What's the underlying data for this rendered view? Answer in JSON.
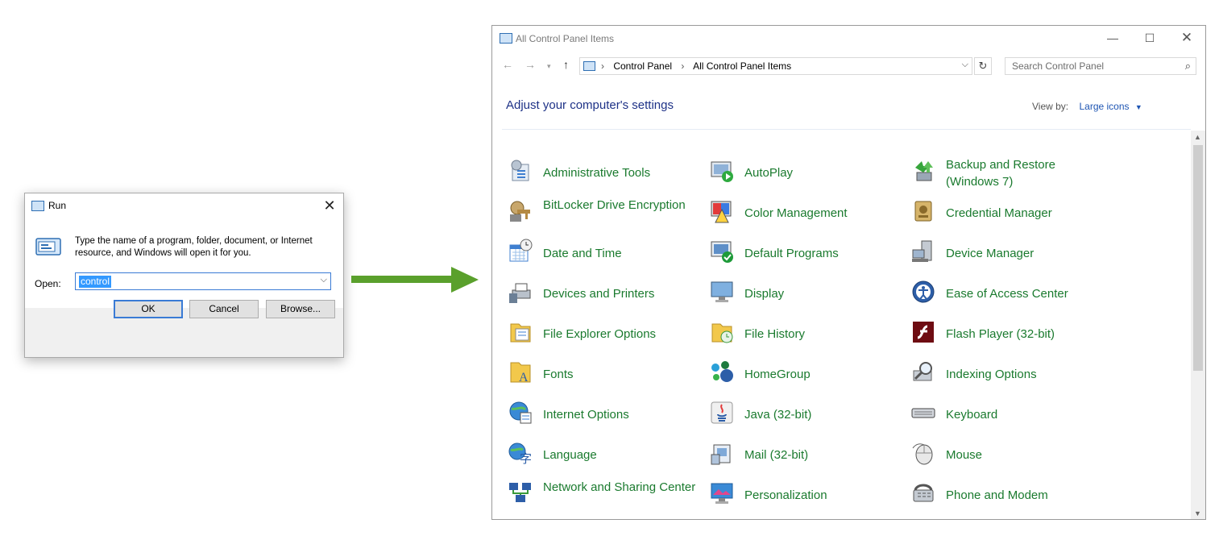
{
  "run_dialog": {
    "title": "Run",
    "description": "Type the name of a program, folder, document, or Internet resource, and Windows will open it for you.",
    "open_label": "Open:",
    "open_value": "control",
    "buttons": {
      "ok": "OK",
      "cancel": "Cancel",
      "browse": "Browse..."
    }
  },
  "control_panel": {
    "window_title": "All Control Panel Items",
    "breadcrumb": [
      "Control Panel",
      "All Control Panel Items"
    ],
    "search_placeholder": "Search Control Panel",
    "heading": "Adjust your computer's settings",
    "view_by_label": "View by:",
    "view_by_value": "Large icons",
    "items": [
      {
        "label": "Administrative Tools",
        "icon": "administrative-tools-icon",
        "col": 0,
        "row": 0
      },
      {
        "label": "AutoPlay",
        "icon": "autoplay-icon",
        "col": 1,
        "row": 0
      },
      {
        "label": "Backup and Restore (Windows 7)",
        "icon": "backup-restore-icon",
        "col": 2,
        "row": 0
      },
      {
        "label": "BitLocker Drive Encryption",
        "icon": "bitlocker-icon",
        "col": 0,
        "row": 1
      },
      {
        "label": "Color Management",
        "icon": "color-management-icon",
        "col": 1,
        "row": 1
      },
      {
        "label": "Credential Manager",
        "icon": "credential-manager-icon",
        "col": 2,
        "row": 1
      },
      {
        "label": "Date and Time",
        "icon": "date-time-icon",
        "col": 0,
        "row": 2
      },
      {
        "label": "Default Programs",
        "icon": "default-programs-icon",
        "col": 1,
        "row": 2
      },
      {
        "label": "Device Manager",
        "icon": "device-manager-icon",
        "col": 2,
        "row": 2
      },
      {
        "label": "Devices and Printers",
        "icon": "devices-printers-icon",
        "col": 0,
        "row": 3
      },
      {
        "label": "Display",
        "icon": "display-icon",
        "col": 1,
        "row": 3
      },
      {
        "label": "Ease of Access Center",
        "icon": "ease-of-access-icon",
        "col": 2,
        "row": 3
      },
      {
        "label": "File Explorer Options",
        "icon": "file-explorer-options-icon",
        "col": 0,
        "row": 4
      },
      {
        "label": "File History",
        "icon": "file-history-icon",
        "col": 1,
        "row": 4
      },
      {
        "label": "Flash Player (32-bit)",
        "icon": "flash-player-icon",
        "col": 2,
        "row": 4
      },
      {
        "label": "Fonts",
        "icon": "fonts-icon",
        "col": 0,
        "row": 5
      },
      {
        "label": "HomeGroup",
        "icon": "homegroup-icon",
        "col": 1,
        "row": 5
      },
      {
        "label": "Indexing Options",
        "icon": "indexing-options-icon",
        "col": 2,
        "row": 5
      },
      {
        "label": "Internet Options",
        "icon": "internet-options-icon",
        "col": 0,
        "row": 6
      },
      {
        "label": "Java (32-bit)",
        "icon": "java-icon",
        "col": 1,
        "row": 6
      },
      {
        "label": "Keyboard",
        "icon": "keyboard-icon",
        "col": 2,
        "row": 6
      },
      {
        "label": "Language",
        "icon": "language-icon",
        "col": 0,
        "row": 7
      },
      {
        "label": "Mail (32-bit)",
        "icon": "mail-icon",
        "col": 1,
        "row": 7
      },
      {
        "label": "Mouse",
        "icon": "mouse-icon",
        "col": 2,
        "row": 7
      },
      {
        "label": "Network and Sharing Center",
        "icon": "network-sharing-icon",
        "col": 0,
        "row": 8
      },
      {
        "label": "Personalization",
        "icon": "personalization-icon",
        "col": 1,
        "row": 8
      },
      {
        "label": "Phone and Modem",
        "icon": "phone-modem-icon",
        "col": 2,
        "row": 8
      }
    ]
  },
  "colors": {
    "item_link": "#1a7a2e",
    "heading": "#1e3287",
    "accent": "#3a7bd5",
    "arrow": "#5aa02c"
  }
}
